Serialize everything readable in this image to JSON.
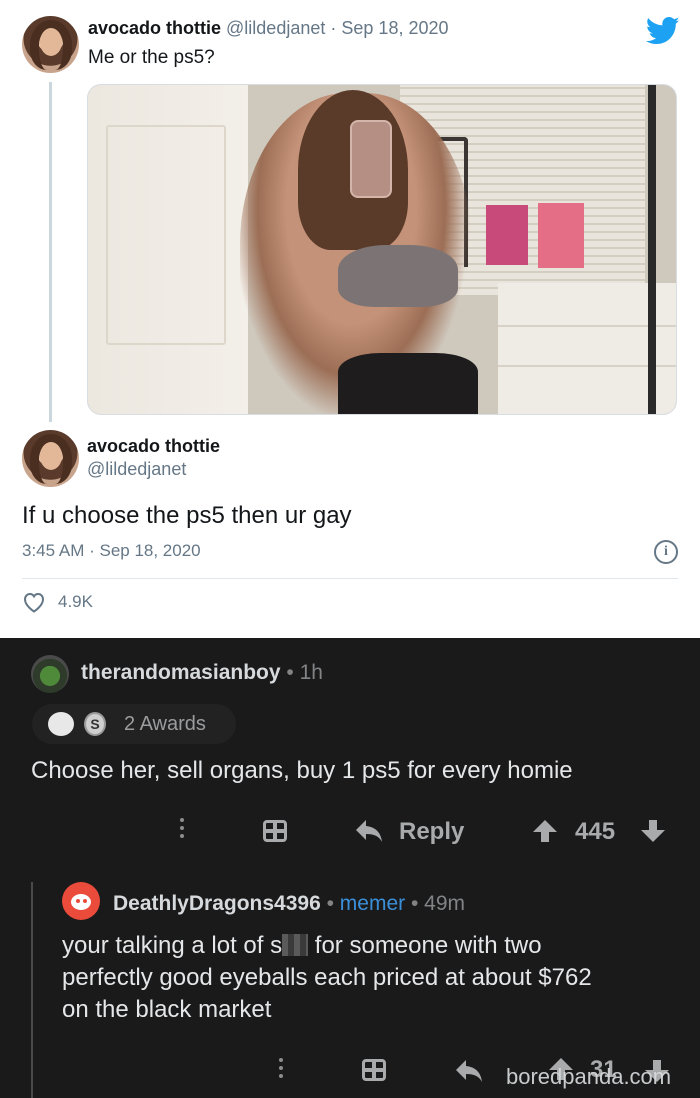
{
  "tweet": {
    "author_name": "avocado thottie",
    "author_handle": "@lildedjanet",
    "date_sep": "·",
    "date": "Sep 18, 2020",
    "text": "Me or the ps5?"
  },
  "reply_tweet": {
    "author_name": "avocado thottie",
    "author_handle": "@lildedjanet",
    "text": "If u choose the ps5 then ur gay",
    "timestamp": "3:45 AM · Sep 18, 2020",
    "likes": "4.9K"
  },
  "comment1": {
    "username": "therandomasianboy",
    "meta": " • 1h",
    "awards": "2 Awards",
    "text": "Choose her, sell organs, buy 1 ps5 for every homie",
    "reply_label": "Reply",
    "score": "445"
  },
  "comment2": {
    "username": "DeathlyDragons4396",
    "flair_sep": " • ",
    "flair": "memer",
    "meta": " • 49m",
    "text_before": "your talking a lot of s",
    "text_after": " for someone with two",
    "text_line2": "perfectly good eyeballs each priced at about $762",
    "text_line3": "on the black market",
    "score": "31"
  },
  "watermark": "boredpanda.com",
  "colors": {
    "twitter_blue": "#1da1f2",
    "reddit_bg": "#1a1a1b",
    "flair_blue": "#3b8fd8"
  }
}
